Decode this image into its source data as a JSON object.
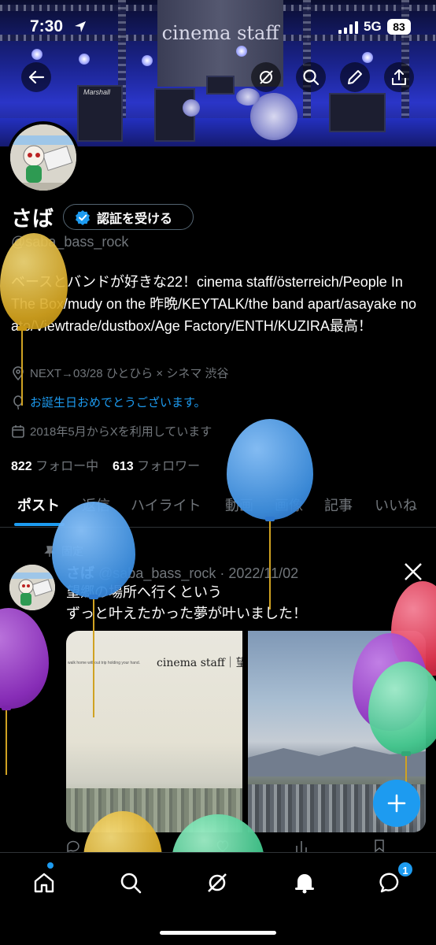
{
  "status_bar": {
    "time": "7:30",
    "network": "5G",
    "battery": "83"
  },
  "banner": {
    "text": "cinema staff",
    "amp_label": "Marshall"
  },
  "profile": {
    "name": "さば",
    "verify_label": "認証を受ける",
    "handle": "@saba_bass_rock",
    "bio": "ベースとバンドが好きな22！cinema staff/österreich/People In The Box/mudy on the 昨晩/KEYTALK/the band apart/asayake no ato/Viewtrade/dustbox/Age Factory/ENTH/KUZIRA最高！",
    "location": "NEXT→03/28 ひとひら × シネマ 渋谷",
    "birthday": "お誕生日おめでとうございます。",
    "joined": "2018年5月からXを利用しています",
    "following_count": "822",
    "following_label": "フォロー中",
    "followers_count": "613",
    "followers_label": "フォロワー"
  },
  "tabs": [
    {
      "label": "ポスト",
      "active": true
    },
    {
      "label": "返信"
    },
    {
      "label": "ハイライト"
    },
    {
      "label": "動画"
    },
    {
      "label": "画像"
    },
    {
      "label": "記事"
    },
    {
      "label": "いいね"
    }
  ],
  "post": {
    "pinned_label": "固定",
    "author": "さば",
    "handle": "@saba_bass_rock",
    "date": "· 2022/11/02",
    "line1": "望郷の場所へ行くという",
    "line2": "ずっと叶えたかった夢が叶いました！",
    "image1_title": "cinema staff｜望",
    "image1_small": "walk home without trip holding your hand."
  },
  "bottom_nav": {
    "messages_badge": "1"
  },
  "icons": [
    "back-arrow-icon",
    "grok-icon",
    "search-icon",
    "edit-icon",
    "share-icon",
    "verified-badge-icon",
    "location-icon",
    "balloon-icon",
    "calendar-icon",
    "pin-icon",
    "x-logo-icon",
    "plus-icon",
    "home-icon",
    "bell-icon",
    "messages-icon"
  ],
  "colors": {
    "accent": "#1d9bf0",
    "muted": "#71767b",
    "text": "#e7e9ea",
    "background": "#000000"
  }
}
